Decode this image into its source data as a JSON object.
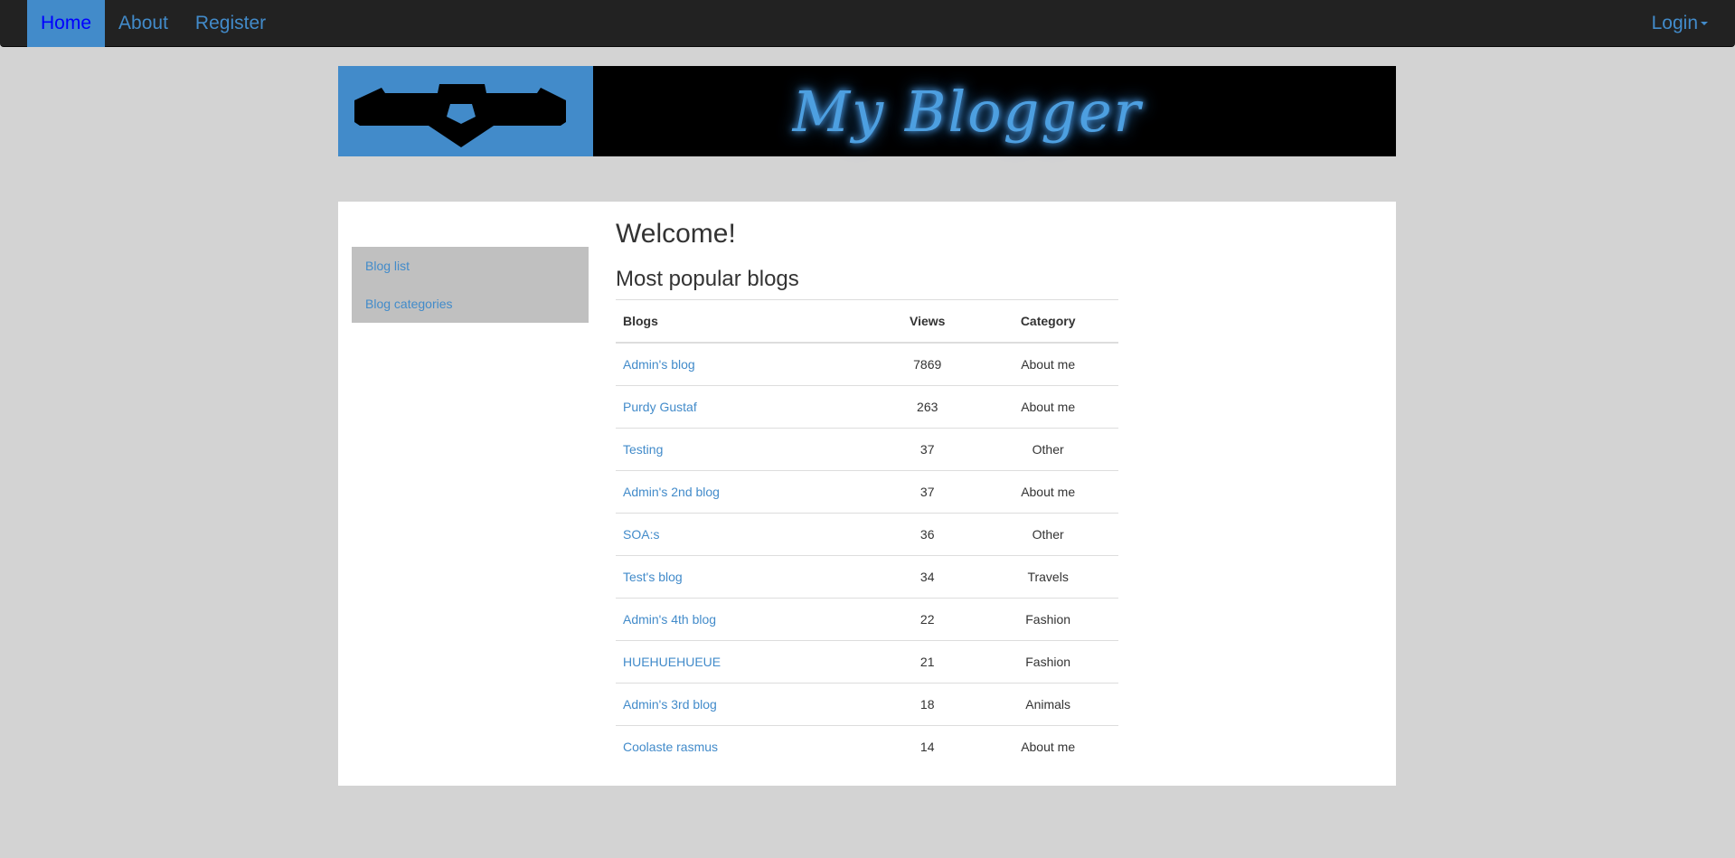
{
  "navbar": {
    "items": [
      {
        "label": "Home"
      },
      {
        "label": "About"
      },
      {
        "label": "Register"
      }
    ],
    "login_label": "Login"
  },
  "banner": {
    "title": "My Blogger",
    "logo_icon": "mask-logo-icon"
  },
  "colors": {
    "background": "#d3d3d3",
    "navbar": "#222222",
    "accent": "#428bca",
    "sidebar": "#c0c0c0"
  },
  "sidebar": {
    "items": [
      {
        "label": "Blog list"
      },
      {
        "label": "Blog categories"
      }
    ]
  },
  "main": {
    "title": "Welcome!",
    "section_title": "Most popular blogs",
    "table": {
      "headers": [
        "Blogs",
        "Views",
        "Category"
      ],
      "rows": [
        {
          "blog": "Admin's blog",
          "views": "7869",
          "category": "About me"
        },
        {
          "blog": "Purdy Gustaf",
          "views": "263",
          "category": "About me"
        },
        {
          "blog": "Testing",
          "views": "37",
          "category": "Other"
        },
        {
          "blog": "Admin's 2nd blog",
          "views": "37",
          "category": "About me"
        },
        {
          "blog": "SOA:s",
          "views": "36",
          "category": "Other"
        },
        {
          "blog": "Test's blog",
          "views": "34",
          "category": "Travels"
        },
        {
          "blog": "Admin's 4th blog",
          "views": "22",
          "category": "Fashion"
        },
        {
          "blog": "HUEHUEHUEUE",
          "views": "21",
          "category": "Fashion"
        },
        {
          "blog": "Admin's 3rd blog",
          "views": "18",
          "category": "Animals"
        },
        {
          "blog": "Coolaste rasmus",
          "views": "14",
          "category": "About me"
        }
      ]
    }
  }
}
